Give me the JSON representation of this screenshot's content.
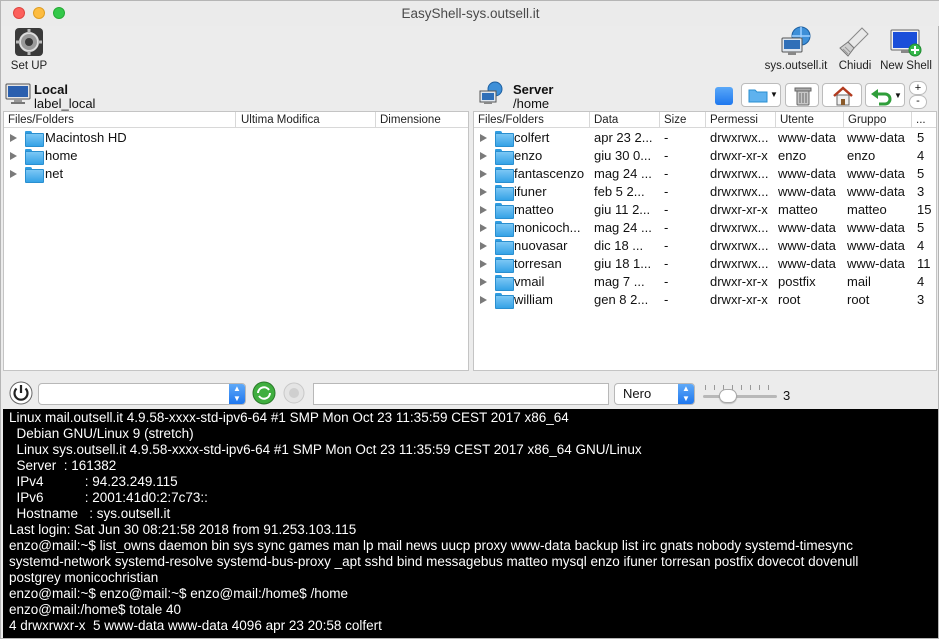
{
  "window": {
    "title": "EasyShell-sys.outsell.it"
  },
  "toolbar": {
    "setup_label": "Set UP",
    "server_label": "sys.outsell.it",
    "close_label": "Chiudi",
    "newshell_label": "New Shell"
  },
  "local": {
    "title": "Local",
    "subtitle": "label_local",
    "columns": [
      "Files/Folders",
      "Ultima Modifica",
      "Dimensione"
    ],
    "rows": [
      {
        "name": "Macintosh HD"
      },
      {
        "name": "home"
      },
      {
        "name": "net"
      }
    ]
  },
  "server": {
    "title": "Server",
    "subtitle": "/home",
    "columns": [
      "Files/Folders",
      "Data",
      "Size",
      "Permessi",
      "Utente",
      "Gruppo",
      "..."
    ],
    "rows": [
      {
        "name": "colfert",
        "date": "apr 23 2...",
        "size": "-",
        "perm": "drwxrwx...",
        "user": "www-data",
        "group": "www-data",
        "n": "5"
      },
      {
        "name": "enzo",
        "date": "giu 30 0...",
        "size": "-",
        "perm": "drwxr-xr-x",
        "user": "enzo",
        "group": "enzo",
        "n": "4"
      },
      {
        "name": "fantascenzo",
        "date": "mag 24 ...",
        "size": "-",
        "perm": "drwxrwx...",
        "user": "www-data",
        "group": "www-data",
        "n": "5"
      },
      {
        "name": "ifuner",
        "date": "feb  5 2...",
        "size": "-",
        "perm": "drwxrwx...",
        "user": "www-data",
        "group": "www-data",
        "n": "3"
      },
      {
        "name": "matteo",
        "date": "giu 11 2...",
        "size": "-",
        "perm": "drwxr-xr-x",
        "user": "matteo",
        "group": "matteo",
        "n": "15"
      },
      {
        "name": "monicoch...",
        "date": "mag 24 ...",
        "size": "-",
        "perm": "drwxrwx...",
        "user": "www-data",
        "group": "www-data",
        "n": "5"
      },
      {
        "name": "nuovasar",
        "date": "dic 18  ...",
        "size": "-",
        "perm": "drwxrwx...",
        "user": "www-data",
        "group": "www-data",
        "n": "4"
      },
      {
        "name": "torresan",
        "date": "giu 18 1...",
        "size": "-",
        "perm": "drwxrwx...",
        "user": "www-data",
        "group": "www-data",
        "n": "11"
      },
      {
        "name": "vmail",
        "date": "mag  7 ...",
        "size": "-",
        "perm": "drwxr-xr-x",
        "user": "postfix",
        "group": "mail",
        "n": "4"
      },
      {
        "name": "william",
        "date": "gen  8 2...",
        "size": "-",
        "perm": "drwxr-xr-x",
        "user": "root",
        "group": "root",
        "n": "3"
      }
    ],
    "plus_label": "+",
    "minus_label": "-"
  },
  "cmdbar": {
    "history_value": "",
    "command_value": "",
    "color_value": "Nero",
    "font_size_value": "3"
  },
  "terminal": {
    "lines": [
      "Linux mail.outsell.it 4.9.58-xxxx-std-ipv6-64 #1 SMP Mon Oct 23 11:35:59 CEST 2017 x86_64",
      "  Debian GNU/Linux 9 (stretch)",
      "  Linux sys.outsell.it 4.9.58-xxxx-std-ipv6-64 #1 SMP Mon Oct 23 11:35:59 CEST 2017 x86_64 GNU/Linux",
      "  Server  : 161382",
      "  IPv4           : 94.23.249.115",
      "  IPv6           : 2001:41d0:2:7c73::",
      "  Hostname   : sys.outsell.it",
      "Last login: Sat Jun 30 08:21:58 2018 from 91.253.103.115",
      "enzo@mail:~$ list_owns daemon bin sys sync games man lp mail news uucp proxy www-data backup list irc gnats nobody systemd-timesync",
      "systemd-network systemd-resolve systemd-bus-proxy _apt sshd bind messagebus matteo mysql enzo ifuner torresan postfix dovecot dovenull",
      "postgrey monicochristian",
      "enzo@mail:~$ enzo@mail:~$ enzo@mail:/home$ /home",
      "enzo@mail:/home$ totale 40",
      "4 drwxrwxr-x  5 www-data www-data 4096 apr 23 20:58 colfert"
    ]
  },
  "colors": {
    "terminal_bg": "#000000",
    "terminal_fg": "#ffffff",
    "accent": "#1f77ee"
  }
}
